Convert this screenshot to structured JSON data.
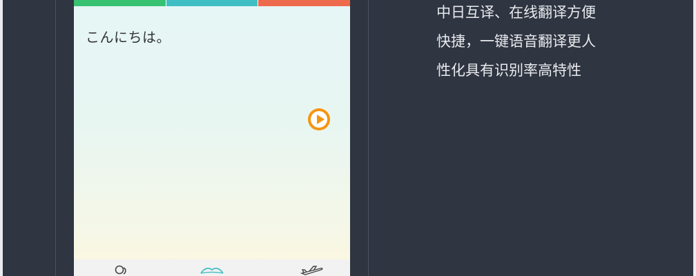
{
  "colors": {
    "tab_green": "#37c272",
    "tab_teal": "#3fbfc3",
    "tab_red": "#ee6a4d",
    "play_orange": "#f5950e",
    "background": "#2f3541"
  },
  "phone": {
    "translated_text": "こんにちは。",
    "play_icon": "play-icon",
    "nav": {
      "items": [
        {
          "icon": "people-icon"
        },
        {
          "icon": "lips-icon"
        },
        {
          "icon": "airplane-icon"
        }
      ]
    }
  },
  "description": {
    "lines": [
      "中日互译、在线翻译方便",
      "快捷，一键语音翻译更人",
      "性化具有识别率高特性"
    ]
  }
}
